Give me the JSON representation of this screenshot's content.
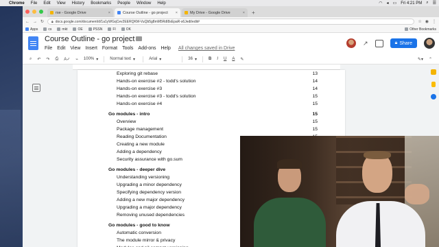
{
  "menubar": {
    "items": [
      "Chrome",
      "File",
      "Edit",
      "View",
      "History",
      "Bookmarks",
      "People",
      "Window",
      "Help"
    ],
    "clock": "Fri 4:21 PM"
  },
  "tabs": [
    {
      "label": "rse - Google Drive"
    },
    {
      "label": "Course Outline - go project"
    },
    {
      "label": "My Drive - Google Drive"
    }
  ],
  "omnibox": {
    "url": "docs.google.com/document/d/1a1yWGqCev2EERQKM-VuQb5g8mM5RdI8sEpaR-s6Jedt/edit#"
  },
  "bookmarks": {
    "items": [
      "Apps",
      "cs",
      "mkt",
      "OE",
      "PSSN",
      "FI",
      "OK",
      "Other Bookmarks"
    ]
  },
  "docs": {
    "title": "Course Outline - go project",
    "menu": [
      "File",
      "Edit",
      "View",
      "Insert",
      "Format",
      "Tools",
      "Add-ons",
      "Help"
    ],
    "saved_status": "All changes saved in Drive",
    "share_label": "Share"
  },
  "toolbar": {
    "zoom": "100%",
    "style": "Normal text",
    "font": "Arial",
    "size": "36",
    "bold": "B",
    "italic": "I",
    "underline": "U",
    "textcolor": "A"
  },
  "toc": [
    {
      "text": "Exploring git rebase",
      "page": "13",
      "kind": "item"
    },
    {
      "text": "Hands-on exercise #2 - todd's solution",
      "page": "14",
      "kind": "item"
    },
    {
      "text": "Hands-on exercise #3",
      "page": "14",
      "kind": "item"
    },
    {
      "text": "Hands-on exercise #3 - todd's solution",
      "page": "15",
      "kind": "item"
    },
    {
      "text": "Hands-on exercise #4",
      "page": "15",
      "kind": "item"
    },
    {
      "text": "Go modules - intro",
      "page": "15",
      "kind": "section"
    },
    {
      "text": "Overview",
      "page": "15",
      "kind": "item"
    },
    {
      "text": "Package management",
      "page": "15",
      "kind": "item"
    },
    {
      "text": "Reading Documentation",
      "page": "15",
      "kind": "item"
    },
    {
      "text": "Creating a new module",
      "page": "",
      "kind": "item"
    },
    {
      "text": "Adding a dependency",
      "page": "",
      "kind": "item"
    },
    {
      "text": "Security assurance with go.sum",
      "page": "",
      "kind": "item"
    },
    {
      "text": "Go modules - deeper dive",
      "page": "",
      "kind": "section"
    },
    {
      "text": "Understanding versioning",
      "page": "",
      "kind": "item"
    },
    {
      "text": "Upgrading a minor dependency",
      "page": "",
      "kind": "item"
    },
    {
      "text": "Specifying dependency version",
      "page": "",
      "kind": "item"
    },
    {
      "text": "Adding a new major dependency",
      "page": "",
      "kind": "item"
    },
    {
      "text": "Upgrading a major dependency",
      "page": "",
      "kind": "item"
    },
    {
      "text": "Removing unused dependencies",
      "page": "",
      "kind": "item"
    },
    {
      "text": "Go modules - good to know",
      "page": "",
      "kind": "section"
    },
    {
      "text": "Automatic conversion",
      "page": "",
      "kind": "item"
    },
    {
      "text": "The module mirror & privacy",
      "page": "",
      "kind": "item"
    },
    {
      "text": "Modules and pil compat versioning",
      "page": "",
      "kind": "item"
    }
  ],
  "colors": {
    "share": "#1a73e8",
    "doc_icon": "#4285f4"
  }
}
